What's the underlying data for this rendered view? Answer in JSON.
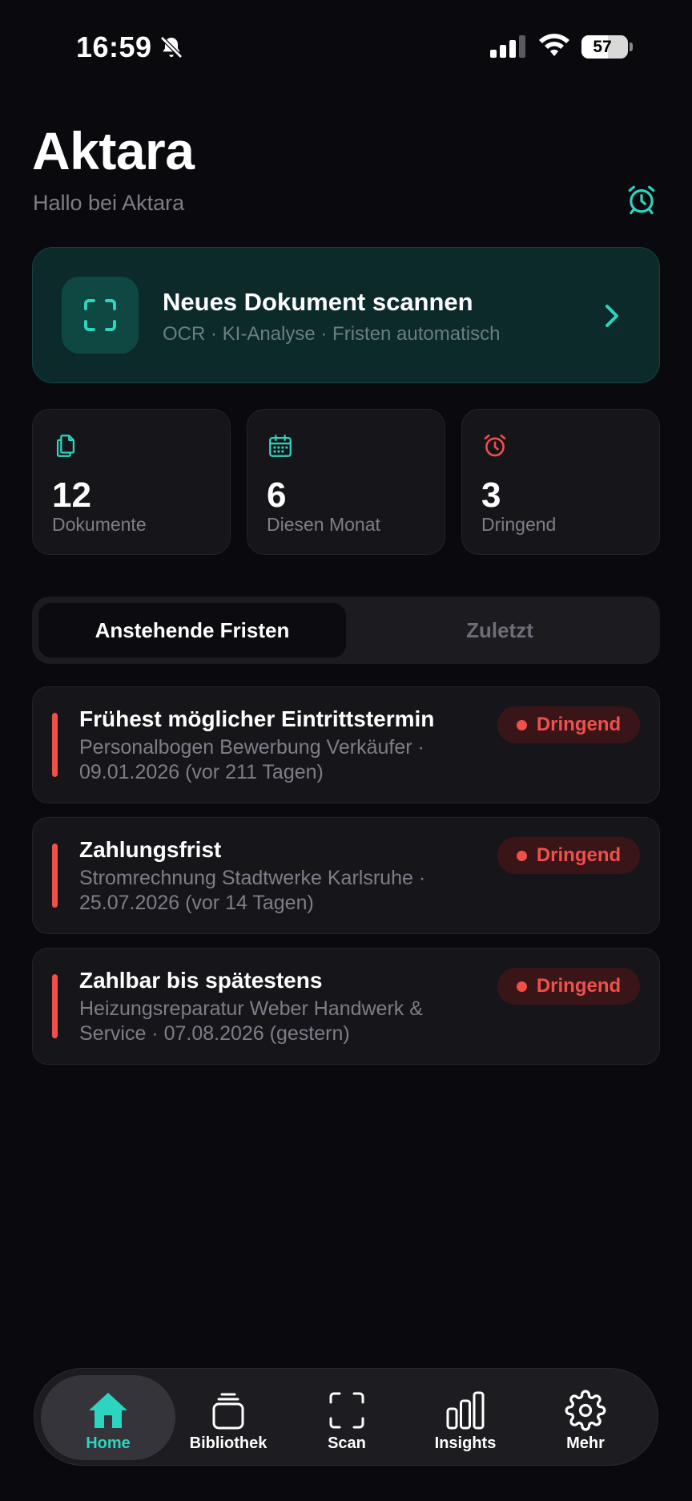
{
  "status_bar": {
    "time": "16:59",
    "battery": "57",
    "battery_level": 0.57
  },
  "header": {
    "title": "Aktara",
    "subtitle": "Hallo bei Aktara"
  },
  "scan_card": {
    "title": "Neues Dokument scannen",
    "subtitle": "OCR · KI-Analyse · Fristen automatisch"
  },
  "stats": [
    {
      "icon": "documents-icon",
      "value": "12",
      "label": "Dokumente"
    },
    {
      "icon": "calendar-icon",
      "value": "6",
      "label": "Diesen Monat"
    },
    {
      "icon": "alarm-icon",
      "value": "3",
      "label": "Dringend"
    }
  ],
  "segments": {
    "active": "Anstehende Fristen",
    "inactive": "Zuletzt"
  },
  "deadlines": [
    {
      "title": "Frühest möglicher Eintrittstermin",
      "description": "Personalbogen Bewerbung Verkäufer · 09.01.2026 (vor 211 Tagen)",
      "badge": "Dringend"
    },
    {
      "title": "Zahlungsfrist",
      "description": "Stromrechnung Stadtwerke Karlsruhe · 25.07.2026 (vor 14 Tagen)",
      "badge": "Dringend"
    },
    {
      "title": "Zahlbar bis spätestens",
      "description": "Heizungsreparatur Weber Handwerk & Service · 07.08.2026 (gestern)",
      "badge": "Dringend"
    }
  ],
  "tabbar": [
    {
      "label": "Home",
      "icon": "home-icon",
      "active": true
    },
    {
      "label": "Bibliothek",
      "icon": "library-icon"
    },
    {
      "label": "Scan",
      "icon": "scan-icon"
    },
    {
      "label": "Insights",
      "icon": "insights-icon"
    },
    {
      "label": "Mehr",
      "icon": "gear-icon"
    }
  ],
  "colors": {
    "accent": "#2dd4bf",
    "urgent": "#f0504c",
    "background": "#0a0a0e",
    "card": "#16161a"
  }
}
